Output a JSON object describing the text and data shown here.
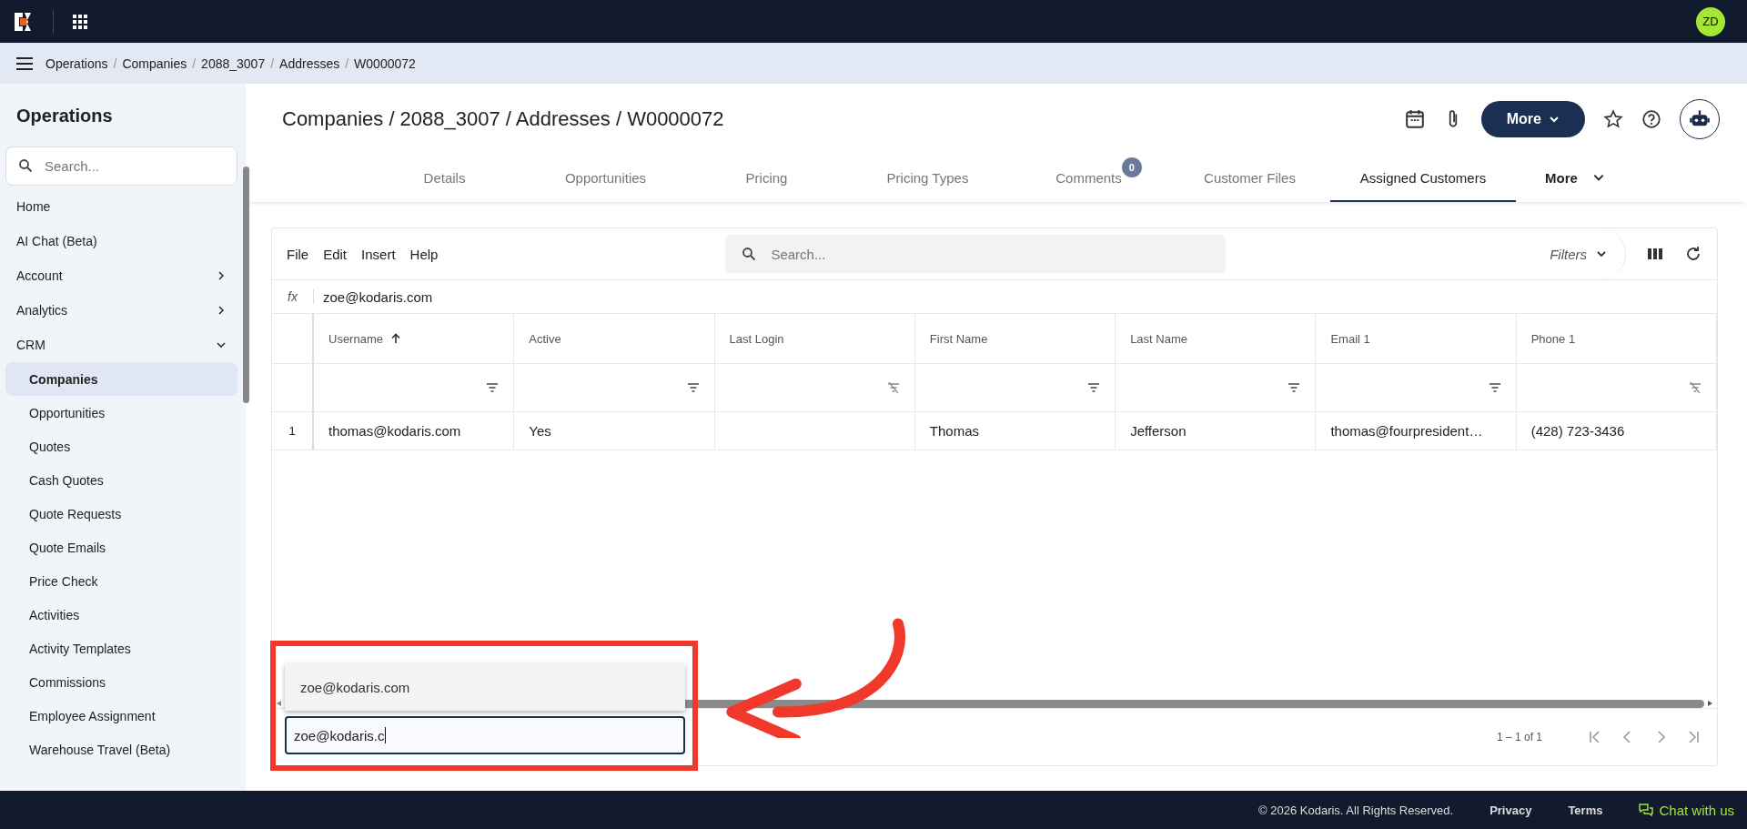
{
  "topbar": {
    "avatar": "ZD"
  },
  "breadcrumb": {
    "separator": "/",
    "items": [
      "Operations",
      "Companies",
      "2088_3007",
      "Addresses",
      "W0000072"
    ]
  },
  "sidebar": {
    "title": "Operations",
    "search": {
      "placeholder": "Search..."
    },
    "items": [
      {
        "label": "Home",
        "kind": "link"
      },
      {
        "label": "AI Chat (Beta)",
        "kind": "link"
      },
      {
        "label": "Account",
        "kind": "group",
        "expanded": false
      },
      {
        "label": "Analytics",
        "kind": "group",
        "expanded": false
      },
      {
        "label": "CRM",
        "kind": "group",
        "expanded": true,
        "children": [
          {
            "label": "Companies",
            "selected": true
          },
          {
            "label": "Opportunities",
            "selected": false
          },
          {
            "label": "Quotes",
            "selected": false
          },
          {
            "label": "Cash Quotes",
            "selected": false
          },
          {
            "label": "Quote Requests",
            "selected": false
          },
          {
            "label": "Quote Emails",
            "selected": false
          },
          {
            "label": "Price Check",
            "selected": false
          },
          {
            "label": "Activities",
            "selected": false
          },
          {
            "label": "Activity Templates",
            "selected": false
          },
          {
            "label": "Commissions",
            "selected": false
          },
          {
            "label": "Employee Assignment",
            "selected": false
          },
          {
            "label": "Warehouse Travel (Beta)",
            "selected": false
          }
        ]
      }
    ]
  },
  "page": {
    "title": "Companies / 2088_3007 / Addresses / W0000072",
    "more_button": "More"
  },
  "tabs": [
    {
      "label": "Details",
      "selected": false,
      "kind": "tab"
    },
    {
      "label": "Opportunities",
      "selected": false,
      "kind": "tab"
    },
    {
      "label": "Pricing",
      "selected": false,
      "kind": "tab"
    },
    {
      "label": "Pricing Types",
      "selected": false,
      "kind": "tab"
    },
    {
      "label": "Comments",
      "selected": false,
      "kind": "tab",
      "badge": "0"
    },
    {
      "label": "Customer Files",
      "selected": false,
      "kind": "tab"
    },
    {
      "label": "Assigned Customers",
      "selected": true,
      "kind": "tab"
    },
    {
      "label": "More",
      "selected": false,
      "kind": "dropdown"
    }
  ],
  "grid": {
    "menu": [
      "File",
      "Edit",
      "Insert",
      "Help"
    ],
    "search": {
      "placeholder": "Search..."
    },
    "filters": "Filters",
    "formula": {
      "label": "fx",
      "value": "zoe@kodaris.com"
    },
    "columns": [
      {
        "label": "Username",
        "sorted_ascending": true,
        "filter_enabled": true
      },
      {
        "label": "Active",
        "sorted_ascending": false,
        "filter_enabled": true
      },
      {
        "label": "Last Login",
        "sorted_ascending": false,
        "filter_enabled": false
      },
      {
        "label": "First Name",
        "sorted_ascending": false,
        "filter_enabled": true
      },
      {
        "label": "Last Name",
        "sorted_ascending": false,
        "filter_enabled": true
      },
      {
        "label": "Email 1",
        "sorted_ascending": false,
        "filter_enabled": true
      },
      {
        "label": "Phone 1",
        "sorted_ascending": false,
        "filter_enabled": false
      }
    ],
    "rows": [
      {
        "number": "1",
        "cells": [
          "thomas@kodaris.com",
          "Yes",
          "",
          "Thomas",
          "Jefferson",
          "thomas@fourpresident…",
          "(428) 723-3436"
        ]
      }
    ],
    "pagination": "1 – 1 of 1",
    "editor": {
      "suggestion": "zoe@kodaris.com",
      "value": "zoe@kodaris.c"
    }
  },
  "footer": {
    "copyright": "© 2026 Kodaris. All Rights Reserved.",
    "links": [
      "Privacy",
      "Terms"
    ],
    "chat": "Chat with us"
  }
}
